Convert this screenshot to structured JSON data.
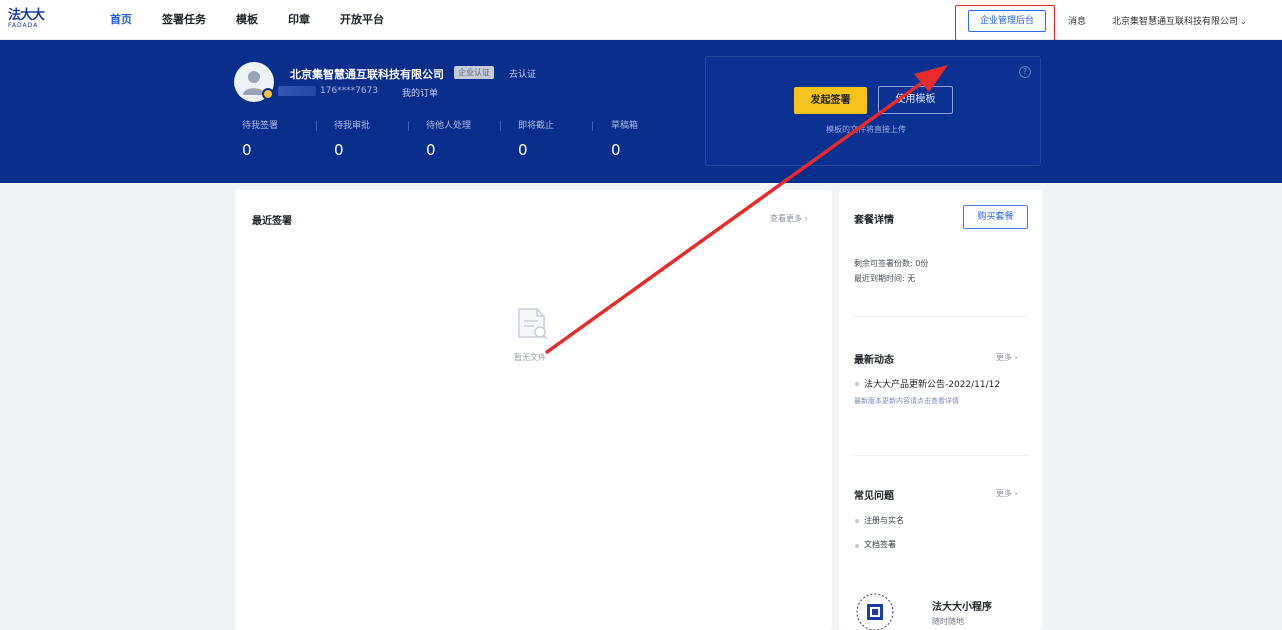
{
  "app": {
    "logo_text": "法大大",
    "logo_sub": "FADADA"
  },
  "nav": {
    "items": [
      {
        "label": "首页",
        "active": true
      },
      {
        "label": "签署任务",
        "active": false
      },
      {
        "label": "模板",
        "active": false
      },
      {
        "label": "印章",
        "active": false
      },
      {
        "label": "开放平台",
        "active": false
      }
    ],
    "mgmt_button": "企业管理后台",
    "messages": "消息",
    "company_menu": "北京集智慧通互联科技有限公司"
  },
  "profile": {
    "company_name": "北京集智慧通互联科技有限公司",
    "ent_tag": "企业认证",
    "verify_link": "去认证",
    "phone": "176****7673",
    "my_orders": "我的订单"
  },
  "stats": [
    {
      "label": "待我签署",
      "value": "0"
    },
    {
      "label": "待我审批",
      "value": "0"
    },
    {
      "label": "待他人处理",
      "value": "0"
    },
    {
      "label": "即将截止",
      "value": "0"
    },
    {
      "label": "草稿箱",
      "value": "0"
    }
  ],
  "actions": {
    "start_sign": "发起签署",
    "template": "使用模板",
    "hint": "模板的文件将直接上传",
    "help": "?"
  },
  "recent": {
    "title": "最近签署",
    "more": "查看更多 ›",
    "empty_text": "暂无文件"
  },
  "package": {
    "title": "套餐详情",
    "buy_button": "购买套餐",
    "line1": "剩余可签署份数: 0份",
    "line2": "最近到期时间: 无"
  },
  "news": {
    "title": "最新动态",
    "more": "更多 ›",
    "item_title": "法大大产品更新公告-2022/11/12",
    "item_sub": "最新版本更新内容请点击查看详情"
  },
  "faq": {
    "title": "常见问题",
    "more": "更多 ›",
    "items": [
      "注册与实名",
      "文档签署"
    ]
  },
  "mini": {
    "title": "法大大小程序",
    "sub": "随时随地"
  },
  "colors": {
    "brand_blue": "#0a2e8c",
    "accent_yellow": "#f6c31c",
    "link_blue": "#1f5fe0",
    "annotation_red": "#e82a2a"
  }
}
